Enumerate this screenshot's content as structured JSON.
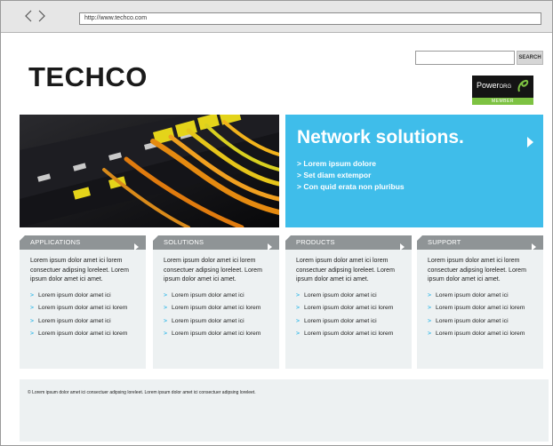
{
  "browser": {
    "url": "http://www.techco.com",
    "back_icon": "chevron-left-icon",
    "forward_icon": "chevron-right-icon"
  },
  "header": {
    "logo": "TECHCO",
    "search": {
      "placeholder": "",
      "button_label": "SEARCH"
    },
    "badge": {
      "brand": "Power",
      "brand_suffix": "ORG",
      "label": "MEMBER"
    }
  },
  "hero": {
    "title": "Network solutions.",
    "items": [
      "> Lorem ipsum dolore",
      "> Set diam extempor",
      "> Con quid erata non pluribus"
    ],
    "accent_color": "#3fbdea"
  },
  "columns": [
    {
      "title": "APPLICATIONS",
      "desc": "Lorem ipsum dolor amet ici lorem consectuer adipsing loreleet. Lorem ipsum dolor amet ici amet.",
      "items": [
        "Lorem ipsum dolor amet ici",
        "Lorem ipsum dolor amet ici lorem",
        "Lorem ipsum dolor amet ici",
        "Lorem ipsum dolor amet ici lorem"
      ]
    },
    {
      "title": "SOLUTIONS",
      "desc": "Lorem ipsum dolor amet ici lorem consectuer adipsing loreleet. Lorem ipsum dolor amet ici amet.",
      "items": [
        "Lorem ipsum dolor amet ici",
        "Lorem ipsum dolor amet ici lorem",
        "Lorem ipsum dolor amet ici",
        "Lorem ipsum dolor amet ici lorem"
      ]
    },
    {
      "title": "PRODUCTS",
      "desc": "Lorem ipsum dolor amet ici lorem consectuer adipsing loreleet. Lorem ipsum dolor amet ici amet.",
      "items": [
        "Lorem ipsum dolor amet ici",
        "Lorem ipsum dolor amet ici lorem",
        "Lorem ipsum dolor amet ici",
        "Lorem ipsum dolor amet ici lorem"
      ]
    },
    {
      "title": "SUPPORT",
      "desc": "Lorem ipsum dolor amet ici lorem consectuer adipsing loreleet. Lorem ipsum dolor amet ici amet.",
      "items": [
        "Lorem ipsum dolor amet ici",
        "Lorem ipsum dolor amet ici lorem",
        "Lorem ipsum dolor amet ici",
        "Lorem ipsum dolor amet ici lorem"
      ]
    }
  ],
  "footer": {
    "text": "© Lorem ipsum dolor amet ici consectuer adipsing loreleet. Lorem ipsum dolor amet ici consectuer adipsing loreleet."
  }
}
